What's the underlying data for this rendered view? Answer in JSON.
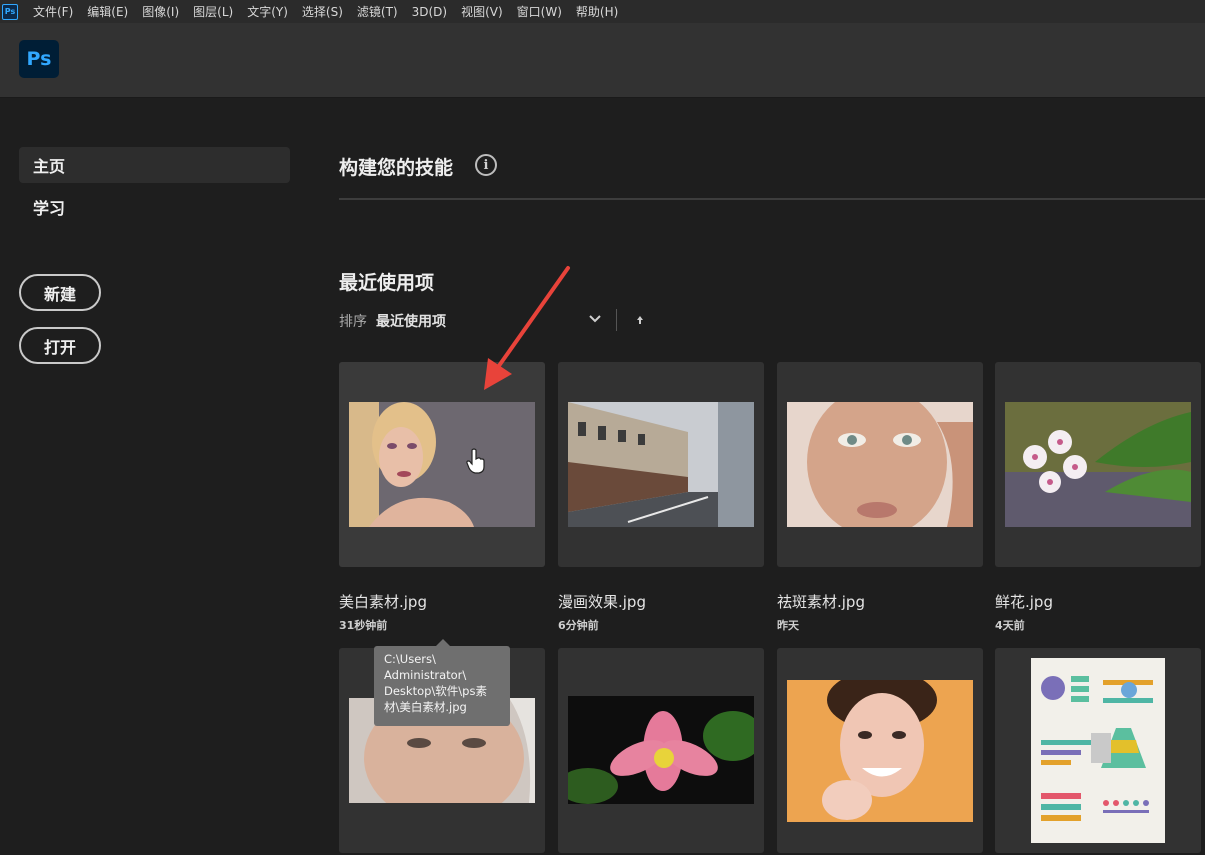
{
  "menubar": {
    "app_icon_text": "Ps",
    "items": [
      "文件(F)",
      "编辑(E)",
      "图像(I)",
      "图层(L)",
      "文字(Y)",
      "选择(S)",
      "滤镜(T)",
      "3D(D)",
      "视图(V)",
      "窗口(W)",
      "帮助(H)"
    ]
  },
  "header": {
    "logo_text": "Ps"
  },
  "sidebar": {
    "nav": [
      {
        "label": "主页",
        "active": true
      },
      {
        "label": "学习",
        "active": false
      }
    ],
    "new_label": "新建",
    "open_label": "打开"
  },
  "main": {
    "skills_title": "构建您的技能",
    "info_glyph": "i",
    "recent_title": "最近使用项",
    "sort_label": "排序",
    "sort_value": "最近使用项",
    "files": [
      {
        "name": "美白素材.jpg",
        "time": "31秒钟前"
      },
      {
        "name": "漫画效果.jpg",
        "time": "6分钟前"
      },
      {
        "name": "祛斑素材.jpg",
        "time": "昨天"
      },
      {
        "name": "鲜花.jpg",
        "time": "4天前"
      },
      {
        "name": "",
        "time": ""
      },
      {
        "name": "",
        "time": ""
      },
      {
        "name": "",
        "time": ""
      },
      {
        "name": "",
        "time": ""
      }
    ],
    "tooltip": "C:\\Users\\\nAdministrator\\\nDesktop\\软件\\ps素\n材\\美白素材.jpg"
  },
  "colors": {
    "accent": "#31a8ff",
    "annotation": "#e8433a"
  }
}
